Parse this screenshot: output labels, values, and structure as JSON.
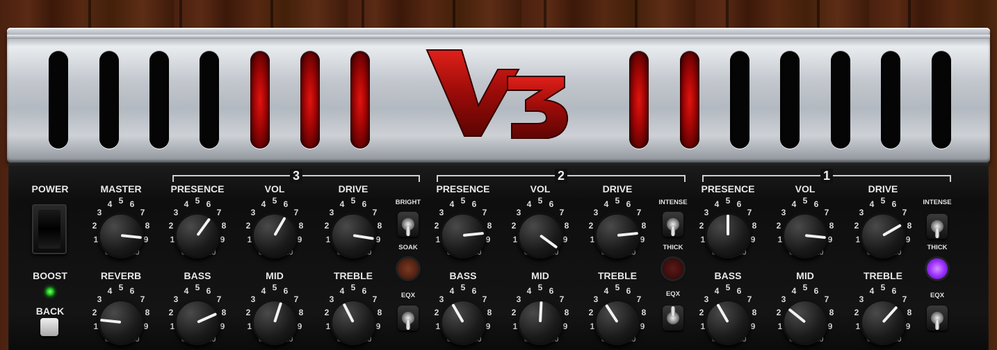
{
  "logo": "V3",
  "top_labels": {
    "power": "POWER",
    "boost": "BOOST",
    "back": "BACK"
  },
  "sections": [
    {
      "number": "3",
      "knobs": [
        "PRESENCE",
        "VOL",
        "DRIVE"
      ]
    },
    {
      "number": "2",
      "knobs": [
        "PRESENCE",
        "VOL",
        "DRIVE"
      ]
    },
    {
      "number": "1",
      "knobs": [
        "PRESENCE",
        "VOL",
        "DRIVE"
      ]
    }
  ],
  "knobs": [
    {
      "id": "master",
      "label": "MASTER",
      "value": 8.2
    },
    {
      "id": "reverb",
      "label": "REVERB",
      "value": 2.2
    },
    {
      "id": "ch3-presence",
      "label": "PRESENCE",
      "value": 6.2
    },
    {
      "id": "ch3-vol",
      "label": "VOL",
      "value": 6.0
    },
    {
      "id": "ch3-drive",
      "label": "DRIVE",
      "value": 8.3
    },
    {
      "id": "ch3-bass",
      "label": "BASS",
      "value": 7.2
    },
    {
      "id": "ch3-mid",
      "label": "MID",
      "value": 5.6
    },
    {
      "id": "ch3-treble",
      "label": "TREBLE",
      "value": 4.1
    },
    {
      "id": "ch2-presence",
      "label": "PRESENCE",
      "value": 7.8
    },
    {
      "id": "ch2-vol",
      "label": "VOL",
      "value": 9.2
    },
    {
      "id": "ch2-drive",
      "label": "DRIVE",
      "value": 7.8
    },
    {
      "id": "ch2-bass",
      "label": "BASS",
      "value": 4.0
    },
    {
      "id": "ch2-mid",
      "label": "MID",
      "value": 5.1
    },
    {
      "id": "ch2-treble",
      "label": "TREBLE",
      "value": 3.9
    },
    {
      "id": "ch1-presence",
      "label": "PRESENCE",
      "value": 5.0
    },
    {
      "id": "ch1-vol",
      "label": "VOL",
      "value": 8.2
    },
    {
      "id": "ch1-drive",
      "label": "DRIVE",
      "value": 7.0
    },
    {
      "id": "ch1-bass",
      "label": "BASS",
      "value": 4.0
    },
    {
      "id": "ch1-mid",
      "label": "MID",
      "value": 3.3
    },
    {
      "id": "ch1-treble",
      "label": "TREBLE",
      "value": 6.4
    }
  ],
  "scale_numbers": [
    "0",
    "1",
    "2",
    "3",
    "4",
    "5",
    "6",
    "7",
    "8",
    "9",
    "10"
  ],
  "switches": {
    "ch3": {
      "top": "BRIGHT",
      "mid": "SOAK",
      "bottom": "EQX"
    },
    "ch2": {
      "top": "INTENSE",
      "mid": "THICK",
      "bottom": "EQX"
    },
    "ch1": {
      "top": "INTENSE",
      "mid": "THICK",
      "bottom": "EQX"
    }
  },
  "colors": {
    "lamp_off": "#5a2a1a",
    "lamp_thick_ch2": "#4a1614",
    "lamp_thick_ch1": "#9b30ff",
    "boost_led": "#22dd22",
    "tube_glow": "#d81010"
  }
}
